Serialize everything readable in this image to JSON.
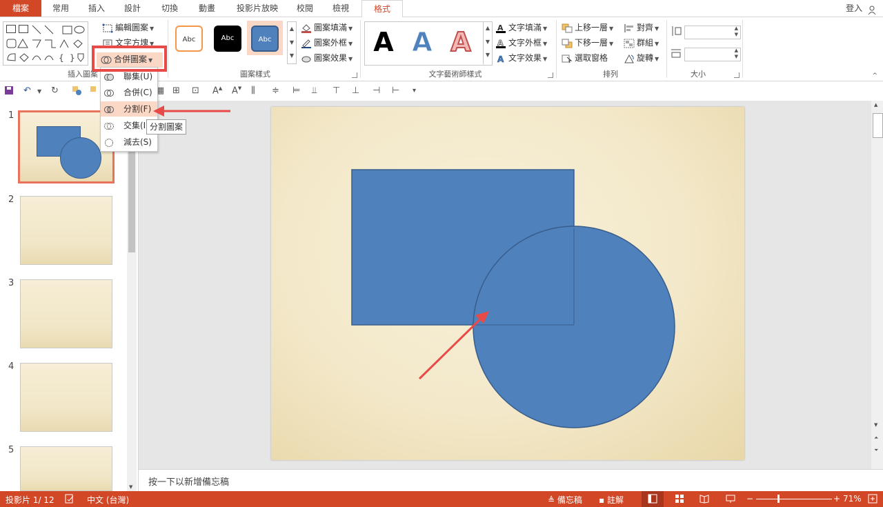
{
  "tabs": {
    "file": "檔案",
    "items": [
      "常用",
      "插入",
      "設計",
      "切換",
      "動畫",
      "投影片放映",
      "校閱",
      "檢視"
    ],
    "active": "格式",
    "signin": "登入"
  },
  "ribbon": {
    "insert_shapes": {
      "label": "插入圖案",
      "edit_shape": "編輯圖案",
      "text_box": "文字方塊",
      "merge_shapes": "合併圖案"
    },
    "shape_styles": {
      "label": "圖案樣式",
      "abc": "Abc",
      "fill": "圖案填滿",
      "outline": "圖案外框",
      "effects": "圖案效果"
    },
    "wordart": {
      "label": "文字藝術師樣式",
      "letter": "A",
      "text_fill": "文字填滿",
      "text_outline": "文字外框",
      "text_effects": "文字效果"
    },
    "arrange": {
      "label": "排列",
      "bring_forward": "上移一層",
      "send_backward": "下移一層",
      "selection_pane": "選取窗格",
      "align": "對齊",
      "group": "群組",
      "rotate": "旋轉"
    },
    "size": {
      "label": "大小"
    }
  },
  "merge_menu": {
    "items": [
      "聯集(U)",
      "合併(C)",
      "分割(F)",
      "交集(I)",
      "減去(S)"
    ],
    "tooltip": "分割圖案"
  },
  "slides": {
    "numbers": [
      "1",
      "2",
      "3",
      "4",
      "5"
    ]
  },
  "notes_placeholder": "按一下以新增備忘稿",
  "status": {
    "slide_info": "投影片 1/ 12",
    "language": "中文 (台灣)",
    "notes": "備忘稿",
    "comments": "註解",
    "zoom": "71%"
  },
  "colors": {
    "accent": "#d24726",
    "shape_fill": "#4f81bd",
    "shape_stroke": "#385d8a",
    "highlight_red": "#e84b47"
  }
}
